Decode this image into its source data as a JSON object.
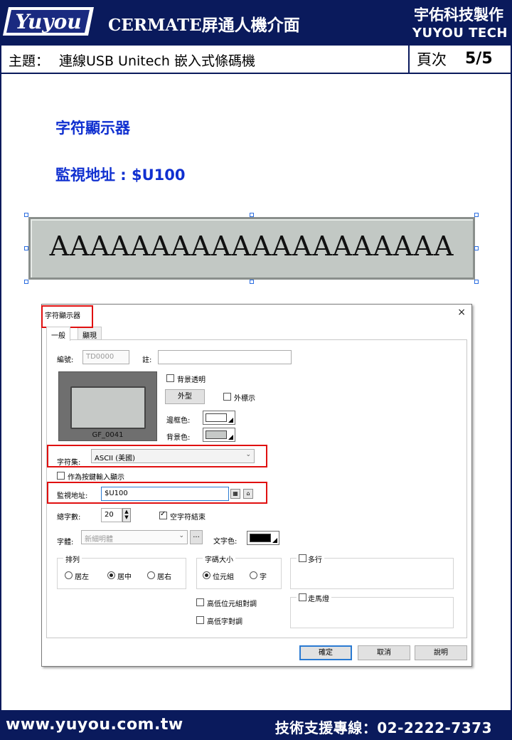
{
  "header": {
    "logo_text": "Yuyou",
    "title": "CERMATE屏通人機介面",
    "company_cn": "宇佑科技製作",
    "company_en": "YUYOU TECH"
  },
  "subject": {
    "key": "主題：",
    "value": "連線USB Unitech 嵌入式條碼機",
    "page_label": "頁次",
    "page_value": "5/5"
  },
  "intro": {
    "heading": "字符顯示器",
    "monitor": "監視地址 : $U100"
  },
  "preview": {
    "text": "AAAAAAAAAAAAAAAAAAAA"
  },
  "dialog": {
    "title": "字符顯示器",
    "close": "×",
    "tabs": [
      "一般",
      "顯現"
    ],
    "id_label": "編號:",
    "id_value": "TD0000",
    "note_label": "註:",
    "note_value": "",
    "bg_transparent": "背景透明",
    "shape_button": "外型",
    "outer_label": "外標示",
    "border_color_label": "邊框色:",
    "bg_color_label": "背景色:",
    "thumb_label": "GF_0041",
    "charset_label": "字符集:",
    "charset_value": "ASCII (美國)",
    "key_input": "作為按鍵輸入顯示",
    "monitor_label": "監視地址:",
    "monitor_value": "$U100",
    "total_chars_label": "總字數:",
    "total_chars_value": "20",
    "null_end": "空字符結束",
    "font_label": "字體:",
    "font_value": "新細明體",
    "font_btn": "...",
    "text_color_label": "文字色:",
    "align": {
      "title": "排列",
      "left": "居左",
      "center": "居中",
      "right": "居右"
    },
    "code_size": {
      "title": "字碼大小",
      "byte": "位元組",
      "char": "字"
    },
    "multiline": "多行",
    "marquee": "走馬燈",
    "swap_byte": "高低位元組對調",
    "swap_word": "高低字對調",
    "ok": "確定",
    "cancel": "取消",
    "help": "說明"
  },
  "footer": {
    "url": "www.yuyou.com.tw",
    "tel": "技術支援專線：02-2222-7373"
  },
  "colors": {
    "brand": "#0a1a5c",
    "heading": "#1030d0",
    "highlight": "#e01010",
    "border_color": "#ffffff",
    "bg_color": "#c6c9c7",
    "text_color": "#000000"
  }
}
